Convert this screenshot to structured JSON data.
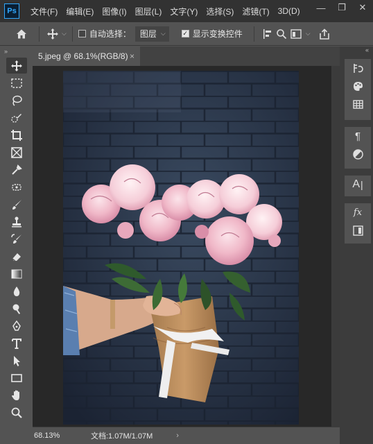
{
  "app": {
    "logo_text": "Ps"
  },
  "menu": [
    "文件(F)",
    "编辑(E)",
    "图像(I)",
    "图层(L)",
    "文字(Y)",
    "选择(S)",
    "滤镜(T)",
    "3D(D)"
  ],
  "window_controls": {
    "minimize": "—",
    "restore": "❐",
    "close": "✕"
  },
  "options": {
    "auto_select_label": "自动选择：",
    "auto_select_checked": false,
    "auto_select_target": "图层",
    "show_transform_label": "显示变换控件",
    "show_transform_checked": true
  },
  "document": {
    "tab_title": "5.jpeg @ 68.1%(RGB/8)",
    "tab_close": "×"
  },
  "status": {
    "zoom": "68.13%",
    "doc_info": "文档:1.07M/1.07M",
    "arrow": "›"
  },
  "tools": [
    "move-tool-icon",
    "marquee-tool-icon",
    "lasso-tool-icon",
    "quick-select-tool-icon",
    "crop-tool-icon",
    "frame-tool-icon",
    "eyedropper-tool-icon",
    "healing-brush-tool-icon",
    "brush-tool-icon",
    "clone-stamp-tool-icon",
    "history-brush-tool-icon",
    "eraser-tool-icon",
    "gradient-tool-icon",
    "blur-tool-icon",
    "dodge-tool-icon",
    "pen-tool-icon",
    "type-tool-icon",
    "path-selection-tool-icon",
    "rectangle-tool-icon",
    "hand-tool-icon",
    "zoom-tool-icon"
  ],
  "right_panels": [
    "history-icon",
    "color-icon",
    "swatches-icon",
    "paragraph-icon",
    "adjustments-icon",
    "character-icon",
    "styles-icon",
    "layers-icon"
  ]
}
